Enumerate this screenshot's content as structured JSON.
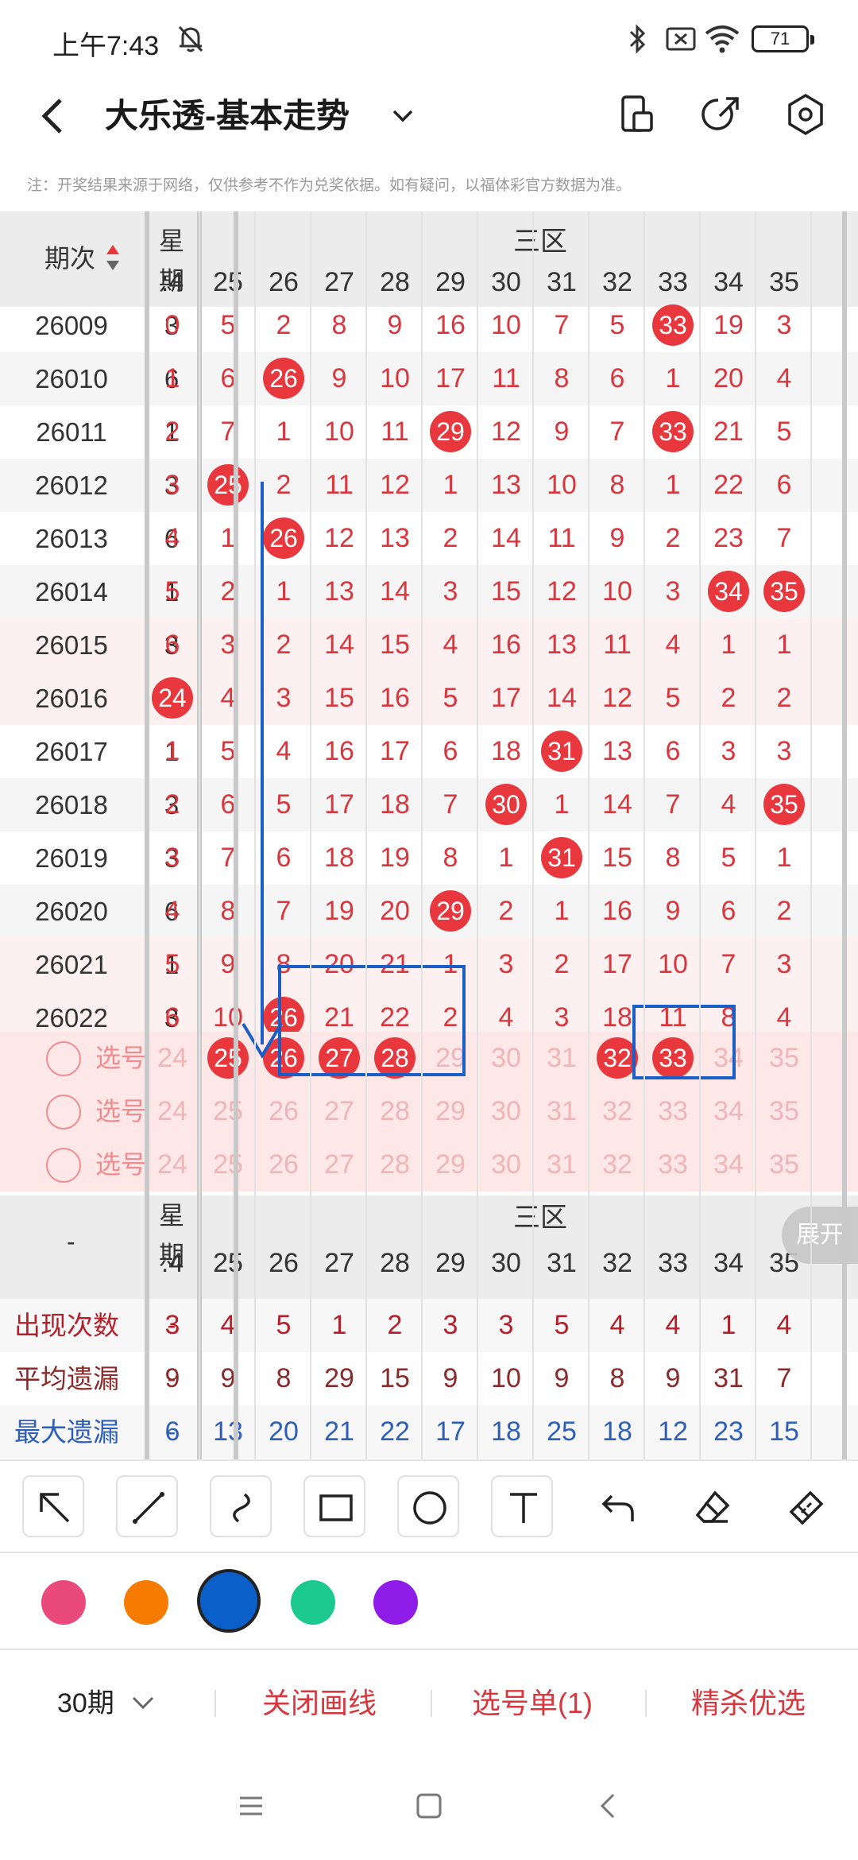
{
  "status": {
    "time": "上午7:43",
    "battery": "71"
  },
  "header": {
    "title": "大乐透-基本走势"
  },
  "note": "注：开奖结果来源于网络，仅供参考不作为兑奖依据。如有疑问，以福体彩官方数据为准。",
  "table": {
    "col_period": "期次",
    "col_week": "星期",
    "zone": "三区",
    "numbers": [
      "24",
      "25",
      "26",
      "27",
      "28",
      "29",
      "30",
      "31",
      "32",
      "33",
      "34",
      "35"
    ],
    "number_labels": [
      ":4",
      "25",
      "26",
      "27",
      "28",
      "29",
      "30",
      "31",
      "32",
      "33",
      "34",
      "35"
    ],
    "rows": [
      {
        "period": "26009",
        "week": "3",
        "cells": [
          "0",
          "5",
          "2",
          "8",
          "9",
          "16",
          "10",
          "7",
          "5",
          "33",
          "19",
          "3"
        ],
        "hit": [
          9
        ]
      },
      {
        "period": "26010",
        "week": "6",
        "cells": [
          "1",
          "6",
          "26",
          "9",
          "10",
          "17",
          "11",
          "8",
          "6",
          "1",
          "20",
          "4"
        ],
        "hit": [
          2
        ]
      },
      {
        "period": "26011",
        "week": "1",
        "cells": [
          "2",
          "7",
          "1",
          "10",
          "11",
          "29",
          "12",
          "9",
          "7",
          "33",
          "21",
          "5"
        ],
        "hit": [
          5,
          9
        ]
      },
      {
        "period": "26012",
        "week": "3",
        "cells": [
          "3",
          "25",
          "2",
          "11",
          "12",
          "1",
          "13",
          "10",
          "8",
          "1",
          "22",
          "6"
        ],
        "hit": [
          1
        ]
      },
      {
        "period": "26013",
        "week": "6",
        "cells": [
          "4",
          "1",
          "26",
          "12",
          "13",
          "2",
          "14",
          "11",
          "9",
          "2",
          "23",
          "7"
        ],
        "hit": [
          2
        ]
      },
      {
        "period": "26014",
        "week": "1",
        "cells": [
          "5",
          "2",
          "1",
          "13",
          "14",
          "3",
          "15",
          "12",
          "10",
          "3",
          "34",
          "35"
        ],
        "hit": [
          10,
          11
        ]
      },
      {
        "period": "26015",
        "week": "3",
        "cells": [
          "6",
          "3",
          "2",
          "14",
          "15",
          "4",
          "16",
          "13",
          "11",
          "4",
          "1",
          "1"
        ],
        "hit": []
      },
      {
        "period": "26016",
        "week": "6",
        "cells": [
          "24",
          "4",
          "3",
          "15",
          "16",
          "5",
          "17",
          "14",
          "12",
          "5",
          "2",
          "2"
        ],
        "hit": [
          0
        ]
      },
      {
        "period": "26017",
        "week": "1",
        "cells": [
          "1",
          "5",
          "4",
          "16",
          "17",
          "6",
          "18",
          "31",
          "13",
          "6",
          "3",
          "3"
        ],
        "hit": [
          7
        ]
      },
      {
        "period": "26018",
        "week": "3",
        "cells": [
          "2",
          "6",
          "5",
          "17",
          "18",
          "7",
          "30",
          "1",
          "14",
          "7",
          "4",
          "35"
        ],
        "hit": [
          6,
          11
        ]
      },
      {
        "period": "26019",
        "week": "3",
        "cells": [
          "3",
          "7",
          "6",
          "18",
          "19",
          "8",
          "1",
          "31",
          "15",
          "8",
          "5",
          "1"
        ],
        "hit": [
          7
        ]
      },
      {
        "period": "26020",
        "week": "6",
        "cells": [
          "4",
          "8",
          "7",
          "19",
          "20",
          "29",
          "2",
          "1",
          "16",
          "9",
          "6",
          "2"
        ],
        "hit": [
          5
        ]
      },
      {
        "period": "26021",
        "week": "1",
        "cells": [
          "5",
          "9",
          "8",
          "20",
          "21",
          "1",
          "3",
          "2",
          "17",
          "10",
          "7",
          "3"
        ],
        "hit": []
      },
      {
        "period": "26022",
        "week": "3",
        "cells": [
          "6",
          "10",
          "26",
          "21",
          "22",
          "2",
          "4",
          "3",
          "18",
          "11",
          "8",
          "4"
        ],
        "hit": [
          2
        ]
      }
    ],
    "select_label": "选号",
    "select_rows": [
      {
        "cells": [
          "24",
          "25",
          "26",
          "27",
          "28",
          "29",
          "30",
          "31",
          "32",
          "33",
          "34",
          "35"
        ],
        "picked": [
          1,
          2,
          3,
          4,
          8,
          9
        ]
      },
      {
        "cells": [
          "24",
          "25",
          "26",
          "27",
          "28",
          "29",
          "30",
          "31",
          "32",
          "33",
          "34",
          "35"
        ],
        "picked": []
      },
      {
        "cells": [
          "24",
          "25",
          "26",
          "27",
          "28",
          "29",
          "30",
          "31",
          "32",
          "33",
          "34",
          "35"
        ],
        "picked": []
      }
    ],
    "stats_dash": "-",
    "stats": [
      {
        "label": "出现次数",
        "dash": "-",
        "color": "#b51f2a",
        "values": [
          "3",
          "4",
          "5",
          "1",
          "2",
          "3",
          "3",
          "5",
          "4",
          "4",
          "1",
          "4"
        ]
      },
      {
        "label": "平均遗漏",
        "dash": "-",
        "color": "#8a2a2a",
        "values": [
          "9",
          "9",
          "8",
          "29",
          "15",
          "9",
          "10",
          "9",
          "8",
          "9",
          "31",
          "7"
        ]
      },
      {
        "label": "最大遗漏",
        "dash": "-",
        "color": "#2e5fb8",
        "values": [
          "6",
          "13",
          "20",
          "21",
          "22",
          "17",
          "18",
          "25",
          "18",
          "12",
          "23",
          "15"
        ]
      }
    ],
    "expand": "展开"
  },
  "palette": [
    "#e94a7b",
    "#f57c00",
    "#0a5fc8",
    "#1bc98e",
    "#8e1be8"
  ],
  "bottom": {
    "period": "30期",
    "close_lines": "关闭画线",
    "ticket": "选号单(1)",
    "best": "精杀优选"
  }
}
